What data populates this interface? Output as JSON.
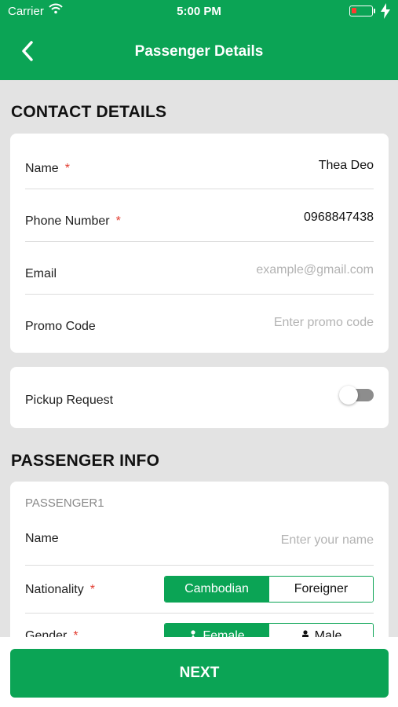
{
  "status_bar": {
    "carrier": "Carrier",
    "time": "5:00 PM",
    "battery_level": 0.15
  },
  "nav": {
    "title": "Passenger Details"
  },
  "contact": {
    "title": "CONTACT DETAILS",
    "name": {
      "label": "Name",
      "required": "*",
      "value": "Thea Deo"
    },
    "phone": {
      "label": "Phone Number",
      "required": "*",
      "value": "0968847438"
    },
    "email": {
      "label": "Email",
      "placeholder": "example@gmail.com"
    },
    "promo": {
      "label": "Promo Code",
      "placeholder": "Enter promo code"
    }
  },
  "pickup": {
    "label": "Pickup Request",
    "enabled": false
  },
  "passenger": {
    "title": "PASSENGER INFO",
    "header": "PASSENGER1",
    "name": {
      "label": "Name",
      "placeholder": "Enter your name"
    },
    "nationality": {
      "label": "Nationality",
      "required": "*",
      "options": [
        "Cambodian",
        "Foreigner"
      ],
      "selected": "Cambodian"
    },
    "gender": {
      "label": "Gender",
      "required": "*",
      "options": [
        "Female",
        "Male"
      ],
      "selected": "Female"
    }
  },
  "footer": {
    "next_label": "NEXT"
  },
  "colors": {
    "brand": "#0ba455",
    "required": "#e23b2f",
    "background": "#e3e3e3"
  },
  "icons": [
    "wifi-icon",
    "battery-icon",
    "charging-bolt-icon",
    "chevron-left-icon",
    "female-icon",
    "male-icon"
  ]
}
